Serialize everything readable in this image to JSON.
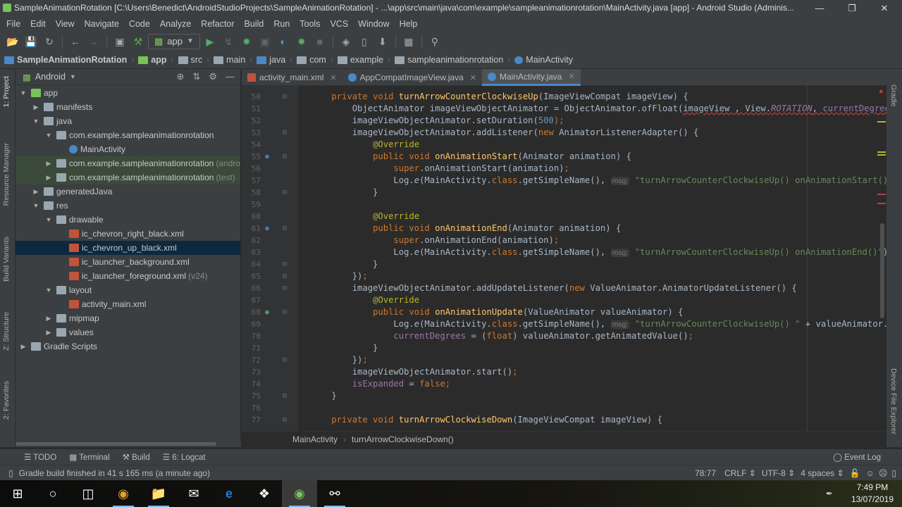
{
  "title": "SampleAnimationRotation [C:\\Users\\Benedict\\AndroidStudioProjects\\SampleAnimationRotation] - ...\\app\\src\\main\\java\\com\\example\\sampleanimationrotation\\MainActivity.java [app] - Android Studio (Adminis...",
  "menu": [
    "File",
    "Edit",
    "View",
    "Navigate",
    "Code",
    "Analyze",
    "Refactor",
    "Build",
    "Run",
    "Tools",
    "VCS",
    "Window",
    "Help"
  ],
  "run_config": "app",
  "breadcrumbs": [
    "SampleAnimationRotation",
    "app",
    "src",
    "main",
    "java",
    "com",
    "example",
    "sampleanimationrotation",
    "MainActivity"
  ],
  "left_stripe": [
    "1: Project",
    "Resource Manager",
    "Build Variants",
    "Z: Structure",
    "2: Favorites"
  ],
  "right_stripe": [
    "Gradle",
    "Device File Explorer"
  ],
  "project": {
    "view": "Android",
    "tree": [
      {
        "label": "app",
        "depth": 0,
        "open": true,
        "icon": "module"
      },
      {
        "label": "manifests",
        "depth": 1,
        "open": false,
        "icon": "folder"
      },
      {
        "label": "java",
        "depth": 1,
        "open": true,
        "icon": "folder"
      },
      {
        "label": "com.example.sampleanimationrotation",
        "depth": 2,
        "open": true,
        "icon": "package"
      },
      {
        "label": "MainActivity",
        "depth": 3,
        "icon": "class"
      },
      {
        "label": "com.example.sampleanimationrotation",
        "suffix": "(andro",
        "depth": 2,
        "open": false,
        "icon": "package",
        "green": true
      },
      {
        "label": "com.example.sampleanimationrotation",
        "suffix": "(test)",
        "depth": 2,
        "open": false,
        "icon": "package",
        "green": true
      },
      {
        "label": "generatedJava",
        "depth": 1,
        "open": false,
        "icon": "folder"
      },
      {
        "label": "res",
        "depth": 1,
        "open": true,
        "icon": "folder"
      },
      {
        "label": "drawable",
        "depth": 2,
        "open": true,
        "icon": "folder"
      },
      {
        "label": "ic_chevron_right_black.xml",
        "depth": 3,
        "icon": "xml"
      },
      {
        "label": "ic_chevron_up_black.xml",
        "depth": 3,
        "icon": "xml",
        "selected": true
      },
      {
        "label": "ic_launcher_background.xml",
        "depth": 3,
        "icon": "xml"
      },
      {
        "label": "ic_launcher_foreground.xml",
        "suffix": "(v24)",
        "depth": 3,
        "icon": "xml"
      },
      {
        "label": "layout",
        "depth": 2,
        "open": true,
        "icon": "folder"
      },
      {
        "label": "activity_main.xml",
        "depth": 3,
        "icon": "xml"
      },
      {
        "label": "mipmap",
        "depth": 2,
        "open": false,
        "icon": "folder"
      },
      {
        "label": "values",
        "depth": 2,
        "open": false,
        "icon": "folder"
      },
      {
        "label": "Gradle Scripts",
        "depth": 0,
        "open": false,
        "icon": "gradle"
      }
    ]
  },
  "tabs": [
    {
      "label": "activity_main.xml",
      "icon": "xml"
    },
    {
      "label": "AppCompatImageView.java",
      "icon": "class"
    },
    {
      "label": "MainActivity.java",
      "icon": "class",
      "active": true
    }
  ],
  "code": [
    {
      "n": "50",
      "t": [
        [
          "    ",
          ""
        ],
        [
          "private void ",
          "kw"
        ],
        [
          "turnArrowCounterClockwiseUp",
          "fn"
        ],
        [
          "(ImageViewCompat imageView) {",
          ""
        ]
      ]
    },
    {
      "n": "51",
      "t": [
        [
          "        ObjectAnimator imageViewObjectAnimator = ObjectAnimator.",
          ""
        ],
        [
          "ofFloat(",
          ""
        ],
        [
          "imageView , View.",
          "err"
        ],
        [
          "ROTATION",
          "fd it err"
        ],
        [
          ", ",
          "err"
        ],
        [
          "currentDegrees",
          "fd err"
        ],
        [
          ", (",
          "err"
        ]
      ]
    },
    {
      "n": "52",
      "t": [
        [
          "        imageViewObjectAnimator.setDuration(",
          ""
        ],
        [
          "500",
          "nu"
        ],
        [
          ");",
          "kw"
        ]
      ]
    },
    {
      "n": "53",
      "t": [
        [
          "        imageViewObjectAnimator.addListener(",
          ""
        ],
        [
          "new ",
          "kw"
        ],
        [
          "AnimatorListenerAdapter() {",
          ""
        ]
      ]
    },
    {
      "n": "54",
      "t": [
        [
          "            ",
          ""
        ],
        [
          "@Override",
          "an"
        ]
      ]
    },
    {
      "n": "55",
      "t": [
        [
          "            ",
          ""
        ],
        [
          "public void ",
          "kw"
        ],
        [
          "onAnimationStart",
          "fn"
        ],
        [
          "(Animator animation) {",
          ""
        ]
      ]
    },
    {
      "n": "56",
      "t": [
        [
          "                ",
          ""
        ],
        [
          "super",
          "kw"
        ],
        [
          ".onAnimationStart(animation)",
          ""
        ],
        [
          ";",
          "kw"
        ]
      ]
    },
    {
      "n": "57",
      "t": [
        [
          "                Log.",
          ""
        ],
        [
          "e",
          "it"
        ],
        [
          "(MainActivity.",
          ""
        ],
        [
          "class",
          "kw"
        ],
        [
          ".getSimpleName(), ",
          ""
        ],
        [
          "msg:",
          "hint"
        ],
        [
          " ",
          ""
        ],
        [
          "\"turnArrowCounterClockwiseUp() onAnimationStart()\"",
          "st"
        ],
        [
          ");",
          ""
        ]
      ]
    },
    {
      "n": "58",
      "t": [
        [
          "            }",
          ""
        ]
      ]
    },
    {
      "n": "59",
      "t": []
    },
    {
      "n": "60",
      "t": [
        [
          "            ",
          ""
        ],
        [
          "@Override",
          "an"
        ]
      ]
    },
    {
      "n": "61",
      "t": [
        [
          "            ",
          ""
        ],
        [
          "public void ",
          "kw"
        ],
        [
          "onAnimationEnd",
          "fn"
        ],
        [
          "(Animator animation) {",
          ""
        ]
      ]
    },
    {
      "n": "62",
      "t": [
        [
          "                ",
          ""
        ],
        [
          "super",
          "kw"
        ],
        [
          ".onAnimationEnd(animation)",
          ""
        ],
        [
          ";",
          "kw"
        ]
      ]
    },
    {
      "n": "63",
      "t": [
        [
          "                Log.",
          ""
        ],
        [
          "e",
          "it"
        ],
        [
          "(MainActivity.",
          ""
        ],
        [
          "class",
          "kw"
        ],
        [
          ".getSimpleName(), ",
          ""
        ],
        [
          "msg:",
          "hint"
        ],
        [
          " ",
          ""
        ],
        [
          "\"turnArrowCounterClockwiseUp() onAnimationEnd()\"",
          "st"
        ],
        [
          ");",
          ""
        ]
      ]
    },
    {
      "n": "64",
      "t": [
        [
          "            }",
          ""
        ]
      ]
    },
    {
      "n": "65",
      "t": [
        [
          "        })",
          ""
        ],
        [
          ";",
          "kw"
        ]
      ]
    },
    {
      "n": "66",
      "t": [
        [
          "        imageViewObjectAnimator.addUpdateListener(",
          ""
        ],
        [
          "new ",
          "kw"
        ],
        [
          "ValueAnimator.AnimatorUpdateListener() {",
          ""
        ]
      ]
    },
    {
      "n": "67",
      "t": [
        [
          "            ",
          ""
        ],
        [
          "@Override",
          "an"
        ]
      ]
    },
    {
      "n": "68",
      "t": [
        [
          "            ",
          ""
        ],
        [
          "public void ",
          "kw"
        ],
        [
          "onAnimationUpdate",
          "fn"
        ],
        [
          "(ValueAnimator valueAnimator) {",
          ""
        ]
      ]
    },
    {
      "n": "69",
      "t": [
        [
          "                Log.",
          ""
        ],
        [
          "e",
          "it"
        ],
        [
          "(MainActivity.",
          ""
        ],
        [
          "class",
          "kw"
        ],
        [
          ".getSimpleName(), ",
          ""
        ],
        [
          "msg:",
          "hint"
        ],
        [
          " ",
          ""
        ],
        [
          "\"turnArrowCounterClockwiseUp() \"",
          "st"
        ],
        [
          " + valueAnimator.getA",
          ""
        ]
      ]
    },
    {
      "n": "70",
      "t": [
        [
          "                ",
          ""
        ],
        [
          "currentDegrees",
          "fd"
        ],
        [
          " = (",
          ""
        ],
        [
          "float",
          "kw"
        ],
        [
          ") valueAnimator.getAnimatedValue()",
          ""
        ],
        [
          ";",
          "kw"
        ]
      ]
    },
    {
      "n": "71",
      "t": [
        [
          "            }",
          ""
        ]
      ]
    },
    {
      "n": "72",
      "t": [
        [
          "        })",
          ""
        ],
        [
          ";",
          "kw"
        ]
      ]
    },
    {
      "n": "73",
      "t": [
        [
          "        imageViewObjectAnimator.start()",
          ""
        ],
        [
          ";",
          "kw"
        ]
      ]
    },
    {
      "n": "74",
      "t": [
        [
          "        ",
          ""
        ],
        [
          "isExpanded",
          "fd"
        ],
        [
          " = ",
          ""
        ],
        [
          "false;",
          "kw"
        ]
      ]
    },
    {
      "n": "75",
      "t": [
        [
          "    }",
          ""
        ]
      ]
    },
    {
      "n": "76",
      "t": []
    },
    {
      "n": "77",
      "t": [
        [
          "    ",
          ""
        ],
        [
          "private void ",
          "kw"
        ],
        [
          "turnArrowClockwiseDown",
          "fn"
        ],
        [
          "(ImageViewCompat imageView) {",
          ""
        ]
      ]
    }
  ],
  "editor_breadcrumb": [
    "MainActivity",
    "turnArrowClockwiseDown()"
  ],
  "tool_windows": [
    "TODO",
    "Terminal",
    "Build",
    "6: Logcat"
  ],
  "event_log": "Event Log",
  "status": {
    "message": "Gradle build finished in 41 s 165 ms (a minute ago)",
    "position": "78:77",
    "line_sep": "CRLF",
    "encoding": "UTF-8",
    "indent": "4 spaces"
  },
  "taskbar": {
    "time": "7:49 PM",
    "date": "13/07/2019"
  },
  "colors": {
    "keyword": "#cc7832",
    "method": "#ffc66d",
    "string": "#6a8759",
    "annotation": "#bbb529",
    "number": "#6897bb",
    "field": "#9876aa",
    "selection": "#0d293e"
  }
}
